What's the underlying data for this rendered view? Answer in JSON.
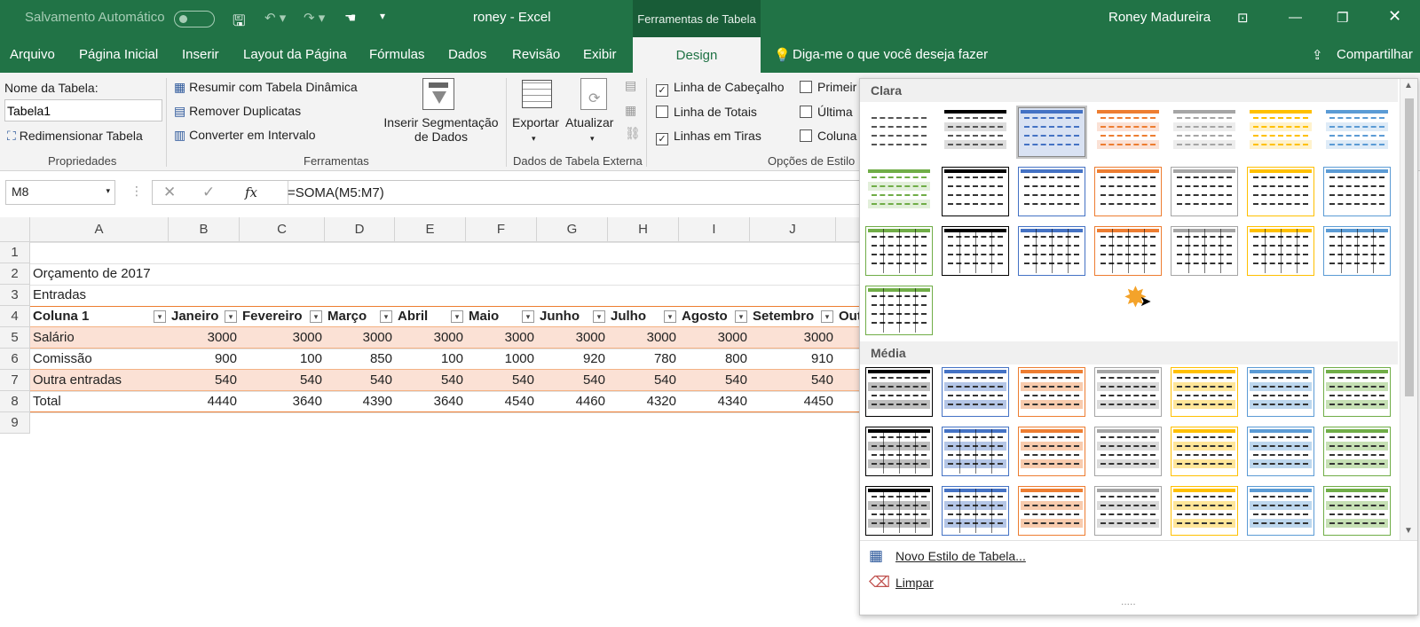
{
  "titlebar": {
    "autosave": "Salvamento Automático",
    "doc": "roney  -  Excel",
    "context": "Ferramentas de Tabela",
    "user": "Roney Madureira"
  },
  "tabs": [
    "Arquivo",
    "Página Inicial",
    "Inserir",
    "Layout da Página",
    "Fórmulas",
    "Dados",
    "Revisão",
    "Exibir"
  ],
  "design_tab": "Design",
  "tellme": "Diga-me o que você deseja fazer",
  "share": "Compartilhar",
  "ribbon": {
    "table_name_label": "Nome da Tabela:",
    "table_name_value": "Tabela1",
    "resize": "Redimensionar Tabela",
    "grp_props": "Propriedades",
    "summarize": "Resumir com Tabela Dinâmica",
    "remove_dup": "Remover Duplicatas",
    "convert": "Converter em Intervalo",
    "insert_seg_1": "Inserir Segmentação",
    "insert_seg_2": "de Dados",
    "grp_tools": "Ferramentas",
    "export": "Exportar",
    "refresh": "Atualizar",
    "grp_ext": "Dados de Tabela Externa",
    "opt_header": "Linha de Cabeçalho",
    "opt_totals": "Linha de Totais",
    "opt_banded": "Linhas em Tiras",
    "opt_first": "Primeir",
    "opt_last": "Última",
    "opt_col": "Coluna",
    "grp_opts": "Opções de Estilo"
  },
  "formula": {
    "namebox": "M8",
    "fx": "fx",
    "value": "=SOMA(M5:M7)"
  },
  "columns": [
    "A",
    "B",
    "C",
    "D",
    "E",
    "F",
    "G",
    "H",
    "I",
    "J"
  ],
  "rows": [
    "1",
    "2",
    "3",
    "4",
    "5",
    "6",
    "7",
    "8",
    "9"
  ],
  "sheet": {
    "r2": "Orçamento de 2017",
    "r3": "Entradas",
    "headers": [
      "Coluna 1",
      "Janeiro",
      "Fevereiro",
      "Março",
      "Abril",
      "Maio",
      "Junho",
      "Julho",
      "Agosto",
      "Setembro",
      "Out"
    ],
    "r5": [
      "Salário",
      "3000",
      "3000",
      "3000",
      "3000",
      "3000",
      "3000",
      "3000",
      "3000",
      "3000"
    ],
    "r6": [
      "Comissão",
      "900",
      "100",
      "850",
      "100",
      "1000",
      "920",
      "780",
      "800",
      "910"
    ],
    "r7": [
      "Outra entradas",
      "540",
      "540",
      "540",
      "540",
      "540",
      "540",
      "540",
      "540",
      "540"
    ],
    "r8": [
      "Total",
      "4440",
      "3640",
      "4390",
      "3640",
      "4540",
      "4460",
      "4320",
      "4340",
      "4450"
    ]
  },
  "gallery": {
    "light": "Clara",
    "medium": "Média",
    "new_style": "Novo Estilo de Tabela...",
    "clear": "Limpar",
    "dots": "....."
  },
  "colors": {
    "green": "#217346",
    "orange": "#ed7d31",
    "band": "#fbe1d5"
  }
}
